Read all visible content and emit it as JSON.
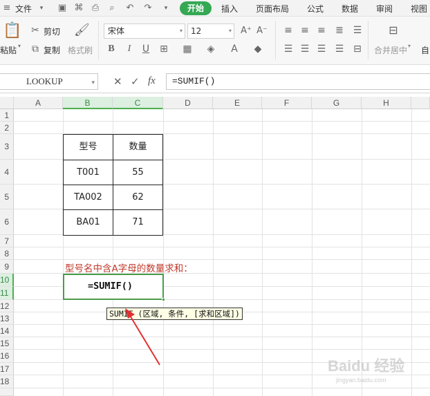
{
  "menu": {
    "file": "文件",
    "tabs": [
      "开始",
      "插入",
      "页面布局",
      "公式",
      "数据",
      "审阅",
      "视图"
    ]
  },
  "ribbon": {
    "paste": "粘贴",
    "cut": "剪切",
    "copy": "复制",
    "format_painter": "格式刷",
    "font_name": "宋体",
    "font_size": "12",
    "merge_center": "合并居中",
    "auto_wrap_partial": "自"
  },
  "formula_bar": {
    "name_box": "LOOKUP",
    "formula": "=SUMIF()",
    "fx": "fx"
  },
  "columns": [
    "A",
    "B",
    "C",
    "D",
    "E",
    "F",
    "G",
    "H"
  ],
  "rows": [
    "1",
    "2",
    "3",
    "4",
    "5",
    "6",
    "7",
    "8",
    "9",
    "10",
    "11",
    "12",
    "13",
    "14",
    "15",
    "16",
    "17",
    "18"
  ],
  "table": {
    "headers": [
      "型号",
      "数量"
    ],
    "rows": [
      [
        "T001",
        "55"
      ],
      [
        "TA002",
        "62"
      ],
      [
        "BA01",
        "71"
      ]
    ]
  },
  "note": "型号名中含A字母的数量求和：",
  "active_cell_text": "=SUMIF()",
  "tooltip": "SUMIF (区域, 条件, [求和区域])",
  "watermark": "Baidu 经验",
  "watermark_sub": "jingyan.baidu.com",
  "colors": {
    "accent_green": "#34a853",
    "selection_green": "#4a9d4a",
    "note_red": "#c0392b",
    "arrow_red": "#e03030"
  }
}
